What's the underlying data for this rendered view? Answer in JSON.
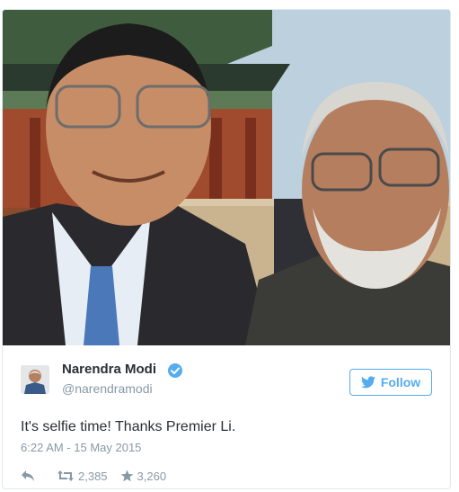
{
  "tweet": {
    "author_name": "Narendra Modi",
    "handle": "@narendramodi",
    "follow_label": "Follow",
    "text": "It's selfie time! Thanks Premier Li.",
    "timestamp": "6:22 AM - 15 May 2015",
    "retweet_count": "2,385",
    "like_count": "3,260"
  },
  "icons": {
    "verified": "verified-badge-icon",
    "follow": "twitter-bird-icon",
    "reply": "reply-arrow-icon",
    "retweet": "retweet-icon",
    "like": "star-icon"
  },
  "colors": {
    "accent": "#55acee",
    "name_text": "#292f33",
    "meta_text": "#8899a6"
  }
}
